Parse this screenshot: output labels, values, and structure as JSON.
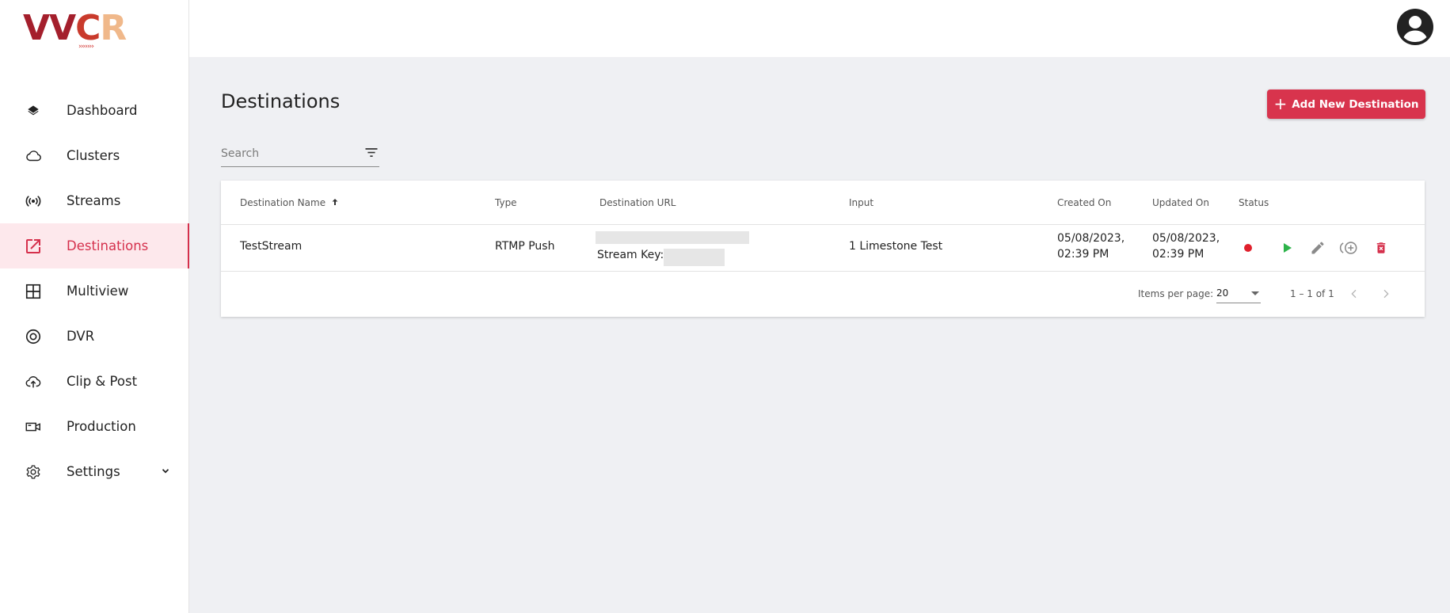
{
  "app": {
    "logo_letters": [
      "V",
      "V",
      "C",
      "R"
    ],
    "logo_arrows": "›››››››"
  },
  "sidebar": {
    "items": [
      {
        "label": "Dashboard",
        "icon": "layers-icon"
      },
      {
        "label": "Clusters",
        "icon": "cloud-icon"
      },
      {
        "label": "Streams",
        "icon": "broadcast-icon"
      },
      {
        "label": "Destinations",
        "icon": "open-in-new-icon",
        "active": true
      },
      {
        "label": "Multiview",
        "icon": "grid-icon"
      },
      {
        "label": "DVR",
        "icon": "record-icon"
      },
      {
        "label": "Clip & Post",
        "icon": "cloud-upload-icon"
      },
      {
        "label": "Production",
        "icon": "video-camera-icon"
      },
      {
        "label": "Settings",
        "icon": "gear-icon",
        "expandable": true
      }
    ]
  },
  "header": {
    "avatar_icon": "account-circle-icon"
  },
  "page": {
    "title": "Destinations",
    "add_button_label": "Add New Destination",
    "search_placeholder": "Search"
  },
  "table": {
    "columns": [
      "Destination Name",
      "Type",
      "Destination URL",
      "Input",
      "Created On",
      "Updated On",
      "Status"
    ],
    "sort_column": "Destination Name",
    "sort_direction": "asc",
    "rows": [
      {
        "name": "TestStream",
        "type": "RTMP Push",
        "url_redacted": true,
        "stream_key_label": "Stream Key:",
        "input": "1 Limestone Test",
        "created_date": "05/08/2023,",
        "created_time": "02:39 PM",
        "updated_date": "05/08/2023,",
        "updated_time": "02:39 PM",
        "status_color": "#e0202c"
      }
    ]
  },
  "pagination": {
    "items_per_page_label": "Items per page:",
    "items_per_page": "20",
    "range": "1 – 1 of 1"
  },
  "colors": {
    "accent": "#d8344d",
    "active_bg": "#fde8ec",
    "play_green": "#2db34a",
    "delete_red": "#d5304c"
  }
}
